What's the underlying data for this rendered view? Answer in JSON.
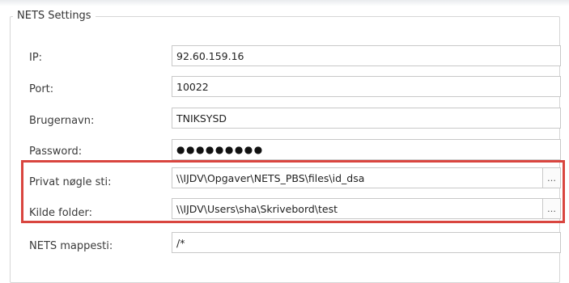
{
  "group": {
    "title": "NETS Settings"
  },
  "fields": {
    "ip": {
      "label": "IP:",
      "value": "92.60.159.16"
    },
    "port": {
      "label": "Port:",
      "value": "10022"
    },
    "username": {
      "label": "Brugernavn:",
      "value": "TNIKSYSD"
    },
    "password": {
      "label": "Password:",
      "value": "●●●●●●●●●"
    },
    "private_key_path": {
      "label": "Privat nøgle sti:",
      "value": "\\\\IJDV\\Opgaver\\NETS_PBS\\files\\id_dsa",
      "browse": "…"
    },
    "source_folder": {
      "label": "Kilde folder:",
      "value": "\\\\IJDV\\Users\\sha\\Skrivebord\\test",
      "browse": "…"
    },
    "nets_folder_path": {
      "label": "NETS mappesti:",
      "value": "/*"
    }
  },
  "colors": {
    "highlight": "#d9453f"
  },
  "icons": {
    "browse": "ellipsis-icon"
  }
}
